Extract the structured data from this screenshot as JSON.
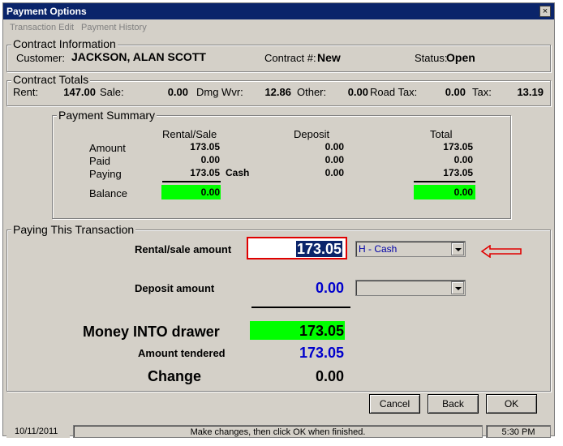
{
  "window": {
    "title": "Payment Options",
    "close_glyph": "×"
  },
  "menu": {
    "transaction_edit": "Transaction Edit",
    "payment_history": "Payment History"
  },
  "contract_info": {
    "legend": "Contract Information",
    "customer_label": "Customer:",
    "customer_value": "JACKSON, ALAN SCOTT",
    "contract_label": "Contract #:",
    "contract_value": "New",
    "status_label": "Status:",
    "status_value": "Open"
  },
  "contract_totals": {
    "legend": "Contract Totals",
    "rent_label": "Rent:",
    "rent_value": "147.00",
    "sale_label": "Sale:",
    "sale_value": "0.00",
    "dmg_label": "Dmg Wvr:",
    "dmg_value": "12.86",
    "other_label": "Other:",
    "other_value": "0.00",
    "road_label": "Road Tax:",
    "road_value": "0.00",
    "tax_label": "Tax:",
    "tax_value": "13.19"
  },
  "payment_summary": {
    "legend": "Payment Summary",
    "col_rental": "Rental/Sale",
    "col_deposit": "Deposit",
    "col_total": "Total",
    "row_amount": "Amount",
    "row_paid": "Paid",
    "row_paying": "Paying",
    "row_balance": "Balance",
    "amount_rental": "173.05",
    "amount_deposit": "0.00",
    "amount_total": "173.05",
    "paid_rental": "0.00",
    "paid_deposit": "0.00",
    "paid_total": "0.00",
    "paying_rental": "173.05",
    "paying_method": "Cash",
    "paying_deposit": "0.00",
    "paying_total": "173.05",
    "balance_rental": "0.00",
    "balance_total": "0.00"
  },
  "paying": {
    "legend": "Paying This Transaction",
    "rental_label": "Rental/sale amount",
    "rental_value": "173.05",
    "rental_method": "H - Cash",
    "deposit_label": "Deposit amount",
    "deposit_value": "0.00",
    "deposit_method": "",
    "money_label": "Money INTO drawer",
    "money_value": "173.05",
    "tendered_label": "Amount tendered",
    "tendered_value": "173.05",
    "change_label": "Change",
    "change_value": "0.00"
  },
  "buttons": {
    "cancel": "Cancel",
    "back": "Back",
    "ok": "OK"
  },
  "statusbar": {
    "date": "10/11/2011",
    "message": "Make changes, then click OK when finished.",
    "time": "5:30 PM"
  },
  "colors": {
    "title_bar": "#0a246a",
    "balance_fill": "#00ff00",
    "blue_value": "#0000cc",
    "highlight_border": "#e00000"
  }
}
